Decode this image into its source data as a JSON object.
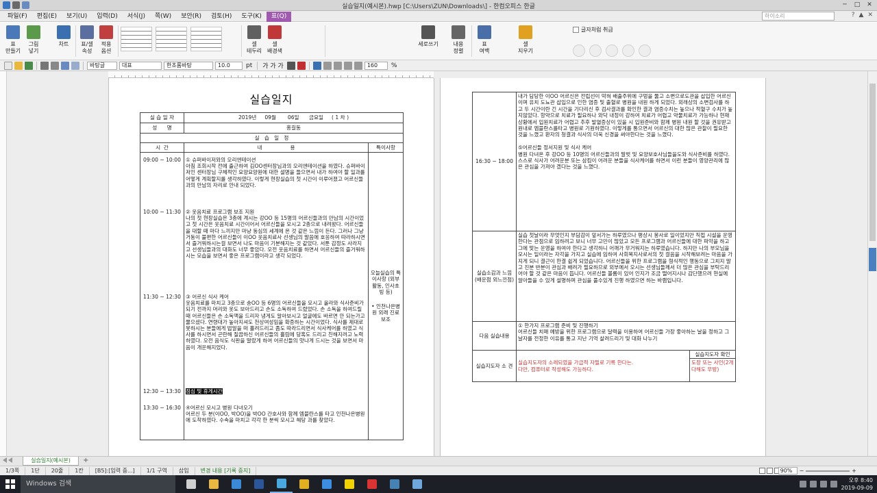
{
  "window": {
    "title": "실습일지(예시본).hwp [C:\\Users\\ZUN\\Downloads\\] - 한컴오피스 한글",
    "controls": [
      "─",
      "□",
      "✕"
    ]
  },
  "menu": {
    "items": [
      "파일(F)",
      "편집(E)",
      "보기(U)",
      "입력(D)",
      "서식(J)",
      "쪽(W)",
      "보안(R)",
      "검토(H)",
      "도구(K)",
      "표(Q)"
    ],
    "active_index": 9,
    "search_placeholder": "하이소리",
    "right_icons": [
      "?",
      "▲",
      "✕"
    ]
  },
  "ribbon": {
    "buttons": [
      {
        "label": "표\n만들기",
        "icon": "table-icon",
        "color": "#4a78b8"
      },
      {
        "label": "그림\n넣기",
        "icon": "image-icon",
        "color": "#5b9a4a"
      },
      {
        "label": "차트",
        "icon": "chart-icon",
        "color": "#3a6fb0"
      },
      {
        "label": "표/셀\n속성",
        "icon": "table-props-icon",
        "color": "#5a6fa0"
      },
      {
        "label": "적용\n옵션",
        "icon": "apply-option-icon",
        "color": "#c04040"
      },
      {
        "label": "셀\n테두리",
        "icon": "cell-border-icon",
        "color": "#606060"
      },
      {
        "label": "셀\n배경색",
        "icon": "cell-fill-icon",
        "color": "#c03838"
      },
      {
        "label": "세로쓰기",
        "icon": "vertical-text-icon",
        "color": "#555555"
      },
      {
        "label": "내용\n정렬",
        "icon": "align-content-icon",
        "color": "#666666"
      },
      {
        "label": "표\n여백",
        "icon": "table-margin-icon",
        "color": "#4a6fa8"
      },
      {
        "label": "셀\n지우기",
        "icon": "clear-cell-icon",
        "color": "#e0a020"
      }
    ],
    "checkbox_label": "글자처럼 취급"
  },
  "format_toolbar": {
    "style": "바탕글",
    "lang": "대표",
    "font": "한초롬바탕",
    "size": "10.0",
    "unit": "pt",
    "bold_italic": "가 가 가",
    "zoom": "160",
    "percent": "%"
  },
  "left_page": {
    "title": "실습일지",
    "date_label": "실 습 일 자",
    "date_value": "2019년     09월       06일      금요일     ( 1 차 )",
    "name_label": "성      명",
    "name_value": "홍길동",
    "section_header": "실   습   일   정",
    "col_time": "시  간",
    "col_content": "내                 용",
    "col_note": "특이사항",
    "entries": [
      {
        "time": "09:00 ~ 10:00",
        "text": "① 슈퍼바이저와의 오리엔테이션\n아침 조회시작 전에 출근하여 김OO센터장님과의 오리엔테이션을 하였다. 슈퍼바이저인 센터장님 구체적인 요양요양원에 대한 설명을 들으면서 내가 하여야 할 일과를 어떻게 계획할지를 생각하였다. 이렇게 현장실습의 첫 시간이 이루어졌고 어르신들과의 만남의 자리로 안내 되었다."
      },
      {
        "time": "10:00 ~ 11:30",
        "text": "② 웃음치료 프로그램 보조 지원\n나의 첫 현장실습은 3층에 계시는 강OO 등 15명의 어르신들과의 만남의 시간이었고 첫 시간은 웃음치료 시간이어서 어르신들을 모시고 2층으로 내려왔다. 어르신들을 대할 때 마다 느끼지만 마냥 동심의 세계에 온 것 같은 느낌이 든다. 그러나 그냥 거동이 불편한 어르신들이 이OO 웃음치료사 선생님의 말씀에 호응하여 따라하시면서 즐거워하시는걸 보면서 나도 마음이 기분해지는 것 같았다. 서툰 감정도 사라지고 선생님들과의 대화도 너무 좋았다. 오전 웃음치료를 하면서 어르신들의 즐거워하시는 모습을 보면서 좋은 프로그램이라고 생각 되었다."
      },
      {
        "time": "11:30 ~ 12:30",
        "text": "③ 어르신 식사 케어\n웃음치료를 마치고 3층으로 송OO 등 6명의 어르신들을 모시고 올라와 식사준비가 되기 전까지 머리와 옷도 보아드리고 손도 소독하여 드렸었다. 손 소독을 하여드릴 때 어르신들은 손 소독액을 드리자 냉게도 알아보시고 얼굴에도 바르면 안 되는가고 물으셨다. 연령대가 높아지셔도 천상여성임을 확증하는 시간이었다. 식사를 제대로 못하시는 분들에게 밥알을 떠 흘려드리고 좀도 따라드리면서 식사케어를 하였고 식사를 하시면서 곤란해 질끔하신 어르신들의 흘림에 당혹도 드리고 친해지려고 노력하였다. 오전 음식도 식판을 말랐게 하여 어르신들의 맛나게 드시는 것을 보면서 마음이 개운해지었다."
      },
      {
        "time": "12:30 ~ 13:30",
        "text": "점심 및 휴게시간",
        "highlight": true
      },
      {
        "time": "13:30 ~ 16:30",
        "text": "④어르신 모시고 병원 다녀오기\n어르신 두 분(이OO, 박OO)을 박OO 간호사와 함께 엠블란스를 타고 인천나은병원에 도착하였다. 수속을 마치고 각각 한 분씩 모시고 해당 과를 찾았다."
      }
    ],
    "note_1": "오늘실습의 특이사항 (외부활동, 인사초빙 등)",
    "note_2": "• 인천나은병원 외래 진료 보조"
  },
  "right_page": {
    "row1_time": "16:30 ~ 18:00",
    "row1_text": "내가 담당한 이OO 어르신은 전립선이 막혀 배출주위에 구멍을 뚫고 소변으로도관을 삽입한 어르신이며 유치 도뇨관 삽입으로 인한 염증 및 출혈로 병원을 내원 하게 되었다. 외래상의 소변검사를 하고 두 시간이란 긴 시간을 기다리신 후 검사결과를 확인한 결과 염증수치는 높으나 적혈구 수치가 높지않았다. 항약으로 치료가 필요하나 와닥 내정이 강하여 치료가 어렵고 약물치료가 가능하나 현재 상황에서 입원치료가 어렵고 추후 발열증상이 있을 시 입원준비와 함께 병원 내원 할 것을 권유받고 원내로 엠블란스를타고 병원로 기원하였다. 이렇게를 통으면서 어르신의 대한 많은 관찰이 필요한 것을 느꼈고 환자의 청결과 식사의 더욱 신경을 써야한다는 것을 느꼈다.\n\n⑤어르신들 정서지원 및 식사 케어\n병원 다녀온 후 강OO 등 10명의 어르신들과의 말벗 및 요양보호사님들을도와 식사준비를 하였다. 스스로 식사가 어려운분 또는 삼킴이 어려운 분들을 식사케어를 하면서 이런 분들이 영양관리에 많은 관심을 가져야 겠다는 것을 느꼈다.",
    "row2_label": "실습소감과 느낌 (배운점 외느낀점)",
    "row2_text": "실습 첫날이라 무엇인지 부담감이 앞서가는 하루였으나 평상시 봉사로 일이었지만 직접 시설을 운영한다는 관점으로 임하려고 보니 너무 고민이 많았고 모든 프로그램과 어르신들에 대한 파악을 하고 그에 맞는 운영을 하여야 한다고 생각하니 어깨가 무거워지는 하루였습니다. 하지만 나의 부모님을 모시는 일이라는 자각을 가지고 실습에 임하여 사회복지사로서의 첫 걸음을 시작해보려는 마음을 가지게 되니 결근이 한결 쉽게 되었습니다. 어르신들을 위한 프로그램을 형식적인 행동으로 그치지 말고 진분 반분이 관심과 배려가 필요하므로 외부에서 오시는 선생님들께서 더 많은 관심을 부탁드리어야 할 것 같은 마음이 듭니다. 어르신들 볼롬이 있어 인지가 조금 떨어지시나 감단했으려 현실에 알아들을 수 있게 설명하며 관심을 풀수있게 진행 하였으면 하는 바램입니다.",
    "row3_label": "다음 실습내용",
    "row3_text": "① 한가지 프로그램 준비 및 진행하기\n어르신들 치매 예방을 위한 프로그램으로 달력을 이용하여 어르신들 가장 좋아하는 날을 정하고 그 날자를 전정한 이유를 통고 지난 기억 살려드리기 및 대화 나누기",
    "row4_label": "실습지도자 소 견",
    "row4_text": "실습지도자의 소레되였을 가급적 자필로 기록 한다는.\n다만, 컴퓨터로 작성해도 가능하다.",
    "row4_sign_label": "실습지도자 확인",
    "row4_sign_text": "도장 또는 사인(2개 다해도 무방)"
  },
  "bottom": {
    "sheet_tab": "실습일지(예시본)",
    "status": [
      "1/3쪽",
      "1단",
      "20줄",
      "1칸",
      "[B5]:[입력 중...]",
      "1/1 구역",
      "삽입",
      "변경 내용 [기록 중지]"
    ],
    "zoom": "90%"
  },
  "taskbar": {
    "search_placeholder": "Windows 검색",
    "time": "오후 8:40",
    "date": "2019-09-09",
    "apps": [
      {
        "icon": "task-view-icon",
        "color": "#d0d0d0"
      },
      {
        "icon": "file-explorer-icon",
        "color": "#e8b840"
      },
      {
        "icon": "vscode-icon",
        "color": "#3a8ad8"
      },
      {
        "icon": "word-icon",
        "color": "#2b579a"
      },
      {
        "icon": "hwp-icon",
        "color": "#4aa8e0"
      },
      {
        "icon": "chrome-icon",
        "color": "#e0b020"
      },
      {
        "icon": "edge-icon",
        "color": "#3b8ee0"
      },
      {
        "icon": "kakaotalk-icon",
        "color": "#f2d200"
      },
      {
        "icon": "acrobat-icon",
        "color": "#d83434"
      },
      {
        "icon": "hancom-icon",
        "color": "#4682b4"
      },
      {
        "icon": "app-icon",
        "color": "#6fa8dc"
      }
    ]
  }
}
